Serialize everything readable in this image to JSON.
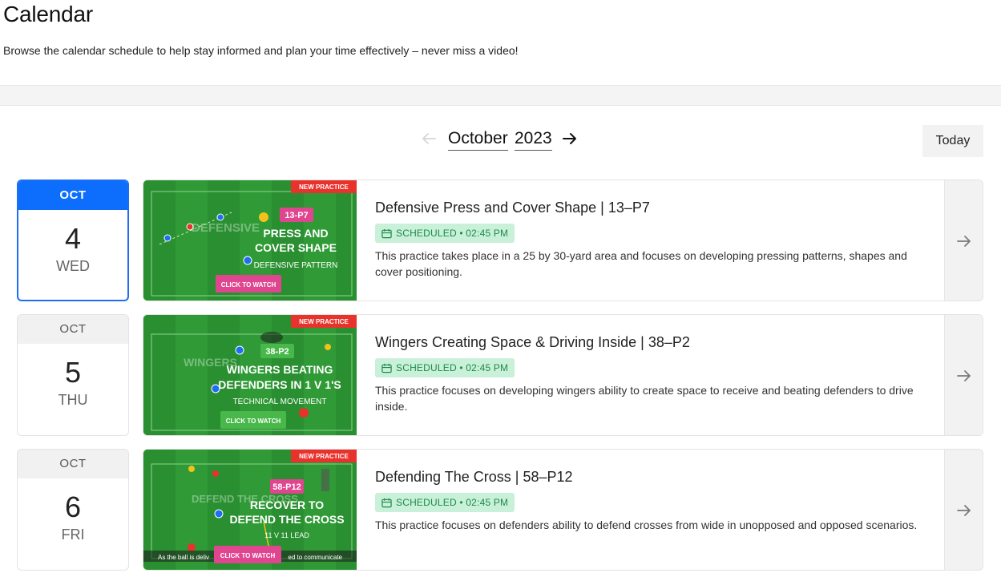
{
  "header": {
    "title": "Calendar",
    "subtitle": "Browse the calendar schedule to help stay informed and plan your time effectively – never miss a video!"
  },
  "nav": {
    "month": "October",
    "year": "2023",
    "prev_icon": "arrow-left-icon",
    "next_icon": "arrow-right-icon",
    "today_label": "Today"
  },
  "colors": {
    "accent": "#0d6efd",
    "badge_bg": "#c9f0d8",
    "badge_text": "#1d8a4a",
    "thumb_tag": "#e8322c",
    "thumb_pink": "#e0458f",
    "pitch_green": "#2f9a36"
  },
  "events": [
    {
      "date": {
        "month": "OCT",
        "day": "4",
        "weekday": "WED"
      },
      "title": "Defensive Press and Cover Shape | 13–P7",
      "status": "SCHEDULED • 02:45 PM",
      "description": "This practice takes place in a 25 by 30-yard area and focuses on developing pressing patterns, shapes and cover positioning.",
      "thumb": {
        "tag": "NEW PRACTICE",
        "code": "13-P7",
        "line1": "PRESS AND",
        "line2": "COVER SHAPE",
        "sub": "DEFENSIVE PATTERN",
        "cta": "CLICK TO WATCH",
        "watermark": "DEFENSIVE"
      }
    },
    {
      "date": {
        "month": "OCT",
        "day": "5",
        "weekday": "THU"
      },
      "title": "Wingers Creating Space & Driving Inside | 38–P2",
      "status": "SCHEDULED • 02:45 PM",
      "description": "This practice focuses on developing wingers ability to create space to receive and beating defenders to drive inside.",
      "thumb": {
        "tag": "NEW PRACTICE",
        "code": "38-P2",
        "line1": "WINGERS BEATING",
        "line2": "DEFENDERS IN 1 V 1'S",
        "sub": "TECHNICAL MOVEMENT",
        "cta": "CLICK TO WATCH",
        "watermark": "WINGERS"
      }
    },
    {
      "date": {
        "month": "OCT",
        "day": "6",
        "weekday": "FRI"
      },
      "title": "Defending The Cross | 58–P12",
      "status": "SCHEDULED • 02:45 PM",
      "description": "This practice focuses on defenders ability to defend crosses from wide in unopposed and opposed scenarios.",
      "thumb": {
        "tag": "NEW PRACTICE",
        "code": "58-P12",
        "line1": "RECOVER TO",
        "line2": "DEFEND THE CROSS",
        "sub": "11 V 11 LEAD",
        "cta": "CLICK TO WATCH",
        "watermark": "DEFEND THE CROSS",
        "caption_left": "As the ball is deliv",
        "caption_right": "ed to communicate"
      }
    }
  ]
}
